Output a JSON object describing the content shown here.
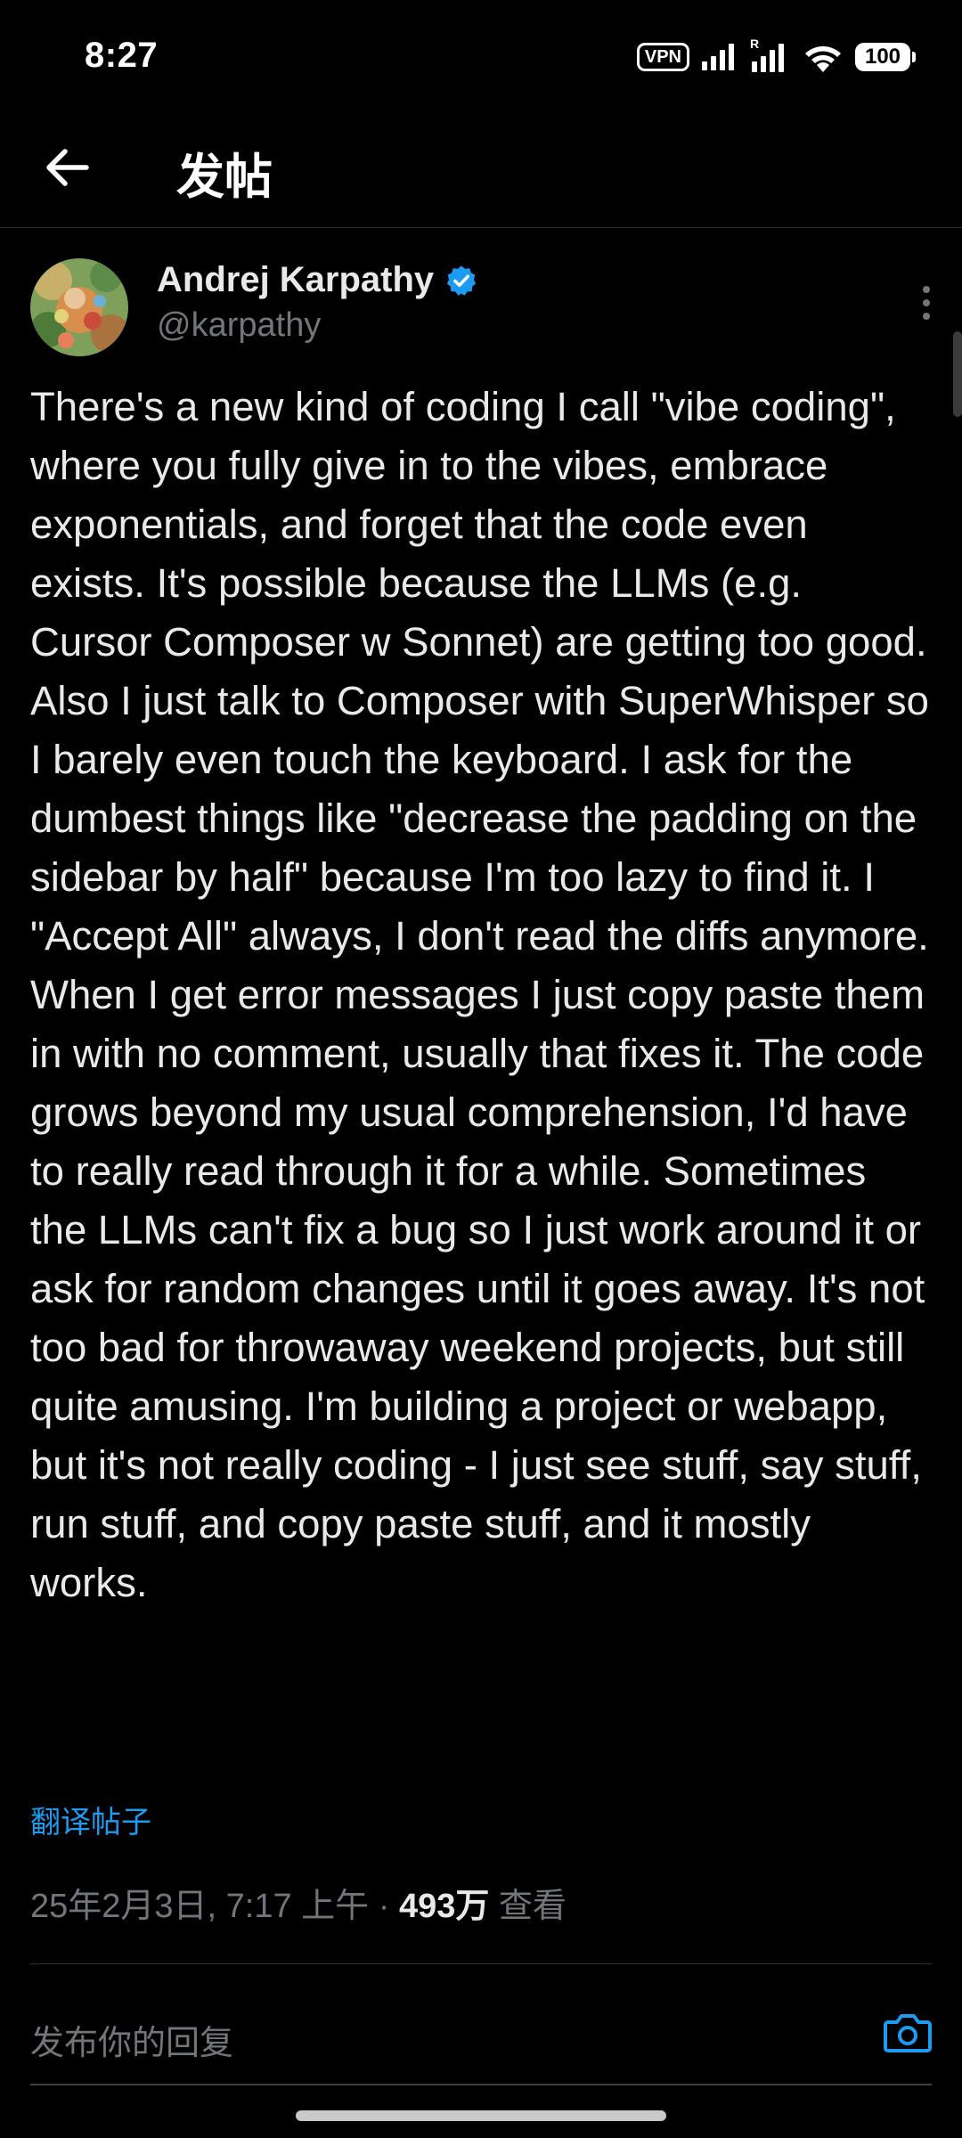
{
  "status_bar": {
    "time": "8:27",
    "vpn_label": "VPN",
    "signal_2_label": "R",
    "battery": "100",
    "icons": [
      "vpn-icon",
      "cellular-signal-icon",
      "cellular-signal-icon",
      "wifi-icon",
      "battery-icon"
    ]
  },
  "header": {
    "title": "发帖",
    "back_icon": "arrow-left-icon"
  },
  "post": {
    "author_name": "Andrej Karpathy",
    "verified": true,
    "handle": "@karpathy",
    "text": "There's a new kind of coding I call \"vibe coding\", where you fully give in to the vibes, embrace exponentials, and forget that the code even exists. It's possible because the LLMs (e.g. Cursor Composer w Sonnet) are getting too good. Also I just talk to Composer with SuperWhisper so I barely even touch the keyboard. I ask for the dumbest things like \"decrease the padding on the sidebar by half\" because I'm too lazy to find it. I \"Accept All\" always, I don't read the diffs anymore. When I get error messages I just copy paste them in with no comment, usually that fixes it. The code grows beyond my usual comprehension, I'd have to really read through it for a while. Sometimes the LLMs can't fix a bug so I just work around it or ask for random changes until it goes away. It's not too bad for throwaway weekend projects, but still quite amusing. I'm building a project or webapp, but it's not really coding - I just see stuff, say stuff, run stuff, and copy paste stuff, and it mostly works.",
    "translate_label": "翻译帖子",
    "timestamp": "25年2月3日, 7:17 上午",
    "separator": " · ",
    "views_count": "493万",
    "views_label": " 查看",
    "more_icon": "more-vertical-icon"
  },
  "reply": {
    "placeholder": "发布你的回复",
    "camera_icon": "camera-icon"
  },
  "colors": {
    "background": "#000000",
    "text": "#e7e9ea",
    "muted": "#71767b",
    "accent": "#1d9bf0",
    "divider": "#2f3336"
  }
}
